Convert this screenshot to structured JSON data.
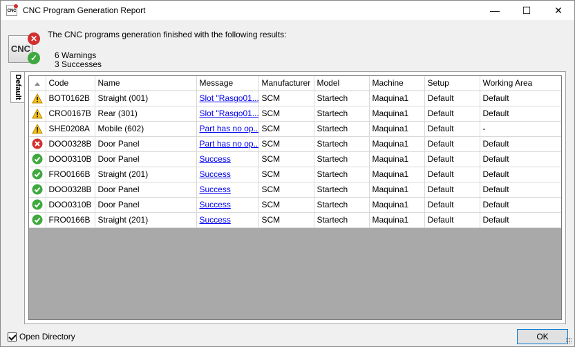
{
  "window": {
    "title": "CNC Program Generation Report",
    "icon_text": "CNC",
    "minimize_glyph": "—",
    "maximize_glyph": "☐",
    "close_glyph": "✕"
  },
  "summary": {
    "icon_text": "CNC",
    "message": "The CNC programs generation finished with the following results:",
    "warnings": "6 Warnings",
    "successes": "3 Successes"
  },
  "tab": {
    "label": "Default"
  },
  "grid": {
    "columns": [
      "",
      "Code",
      "Name",
      "Message",
      "Manufacturer",
      "Model",
      "Machine",
      "Setup",
      "Working Area"
    ],
    "rows": [
      {
        "status": "warning",
        "code": "BOT0162B",
        "name": "Straight (001)",
        "message": "Slot \"Rasgo01...",
        "manufacturer": "SCM",
        "model": "Startech",
        "machine": "Maquina1",
        "setup": "Default",
        "area": "Default"
      },
      {
        "status": "warning",
        "code": "CRO0167B",
        "name": "Rear (301)",
        "message": "Slot \"Rasgo01...",
        "manufacturer": "SCM",
        "model": "Startech",
        "machine": "Maquina1",
        "setup": "Default",
        "area": "Default"
      },
      {
        "status": "warning",
        "code": "SHE0208A",
        "name": "Mobile (602)",
        "message": "Part has no op...",
        "manufacturer": "SCM",
        "model": "Startech",
        "machine": "Maquina1",
        "setup": "Default",
        "area": "-"
      },
      {
        "status": "error",
        "code": "DOO0328B",
        "name": "Door Panel",
        "message": "Part has no op...",
        "manufacturer": "SCM",
        "model": "Startech",
        "machine": "Maquina1",
        "setup": "Default",
        "area": "Default"
      },
      {
        "status": "success",
        "code": "DOO0310B",
        "name": "Door Panel",
        "message": "Success",
        "manufacturer": "SCM",
        "model": "Startech",
        "machine": "Maquina1",
        "setup": "Default",
        "area": "Default"
      },
      {
        "status": "success",
        "code": "FRO0166B",
        "name": "Straight (201)",
        "message": "Success",
        "manufacturer": "SCM",
        "model": "Startech",
        "machine": "Maquina1",
        "setup": "Default",
        "area": "Default"
      },
      {
        "status": "success",
        "code": "DOO0328B",
        "name": "Door Panel",
        "message": "Success",
        "manufacturer": "SCM",
        "model": "Startech",
        "machine": "Maquina1",
        "setup": "Default",
        "area": "Default"
      },
      {
        "status": "success",
        "code": "DOO0310B",
        "name": "Door Panel",
        "message": "Success",
        "manufacturer": "SCM",
        "model": "Startech",
        "machine": "Maquina1",
        "setup": "Default",
        "area": "Default"
      },
      {
        "status": "success",
        "code": "FRO0166B",
        "name": "Straight (201)",
        "message": "Success",
        "manufacturer": "SCM",
        "model": "Startech",
        "machine": "Maquina1",
        "setup": "Default",
        "area": "Default"
      }
    ]
  },
  "footer": {
    "open_directory_label": "Open Directory",
    "open_directory_checked": true,
    "ok_label": "OK"
  },
  "icons": {
    "warning": "warning-icon",
    "error": "error-icon",
    "success": "success-icon"
  }
}
